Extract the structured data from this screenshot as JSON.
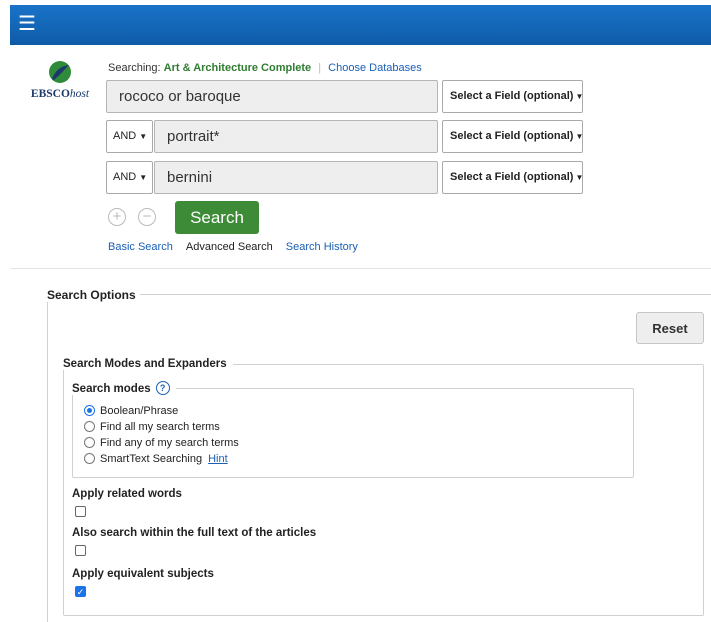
{
  "header": {
    "menu_icon": "hamburger-menu-icon"
  },
  "logo": {
    "brand": "EBSCO",
    "suffix": "host"
  },
  "search": {
    "searching_label": "Searching:",
    "database": "Art & Architecture Complete",
    "choose_databases": "Choose Databases",
    "rows": [
      {
        "operator": "",
        "term": "rococo or baroque",
        "field": "Select a Field (optional)"
      },
      {
        "operator": "AND",
        "term": "portrait*",
        "field": "Select a Field (optional)"
      },
      {
        "operator": "AND",
        "term": "bernini",
        "field": "Select a Field (optional)"
      }
    ],
    "add_row": "+",
    "remove_row": "−",
    "search_button": "Search",
    "links": {
      "basic": "Basic Search",
      "advanced": "Advanced Search",
      "history": "Search History"
    }
  },
  "options": {
    "title": "Search Options",
    "reset_button": "Reset",
    "modes_expanders_title": "Search Modes and Expanders",
    "modes_title": "Search modes",
    "help": "?",
    "modes": [
      {
        "label": "Boolean/Phrase",
        "selected": true
      },
      {
        "label": "Find all my search terms",
        "selected": false
      },
      {
        "label": "Find any of my search terms",
        "selected": false
      },
      {
        "label": "SmartText Searching",
        "selected": false,
        "hint": "Hint"
      }
    ],
    "expanders": [
      {
        "label": "Apply related words",
        "checked": false
      },
      {
        "label": "Also search within the full text of the articles",
        "checked": false
      },
      {
        "label": "Apply equivalent subjects",
        "checked": true
      }
    ],
    "check_mark": "✓"
  },
  "colors": {
    "header": "#1a73c8",
    "search_button": "#3d8b37",
    "link": "#1a5fb4",
    "database": "#2e7d32"
  }
}
